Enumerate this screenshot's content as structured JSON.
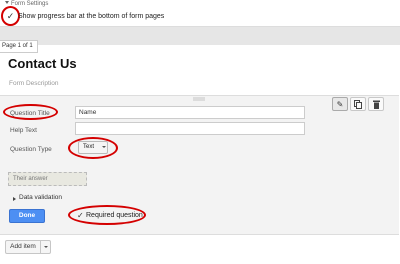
{
  "form_settings": {
    "label": "Form Settings",
    "show_progress_checked": true,
    "show_progress_label": "Show progress bar at the bottom of form pages"
  },
  "page_label": "Page 1 of 1",
  "form": {
    "title": "Contact Us",
    "description_placeholder": "Form Description"
  },
  "question": {
    "title_label": "Question Title",
    "title_value": "Name",
    "help_label": "Help Text",
    "help_value": "",
    "type_label": "Question Type",
    "type_value": "Text",
    "answer_preview": "Their answer",
    "data_validation_label": "Data validation",
    "done_label": "Done",
    "required_checked": true,
    "required_label": "Required question",
    "toolbar": {
      "edit_icon": "pencil-icon",
      "duplicate_icon": "duplicate-icon",
      "delete_icon": "trash-icon"
    }
  },
  "add_item": {
    "label": "Add item"
  },
  "colors": {
    "annotation_ring": "#d40000",
    "done_button": "#4d8ff3"
  }
}
